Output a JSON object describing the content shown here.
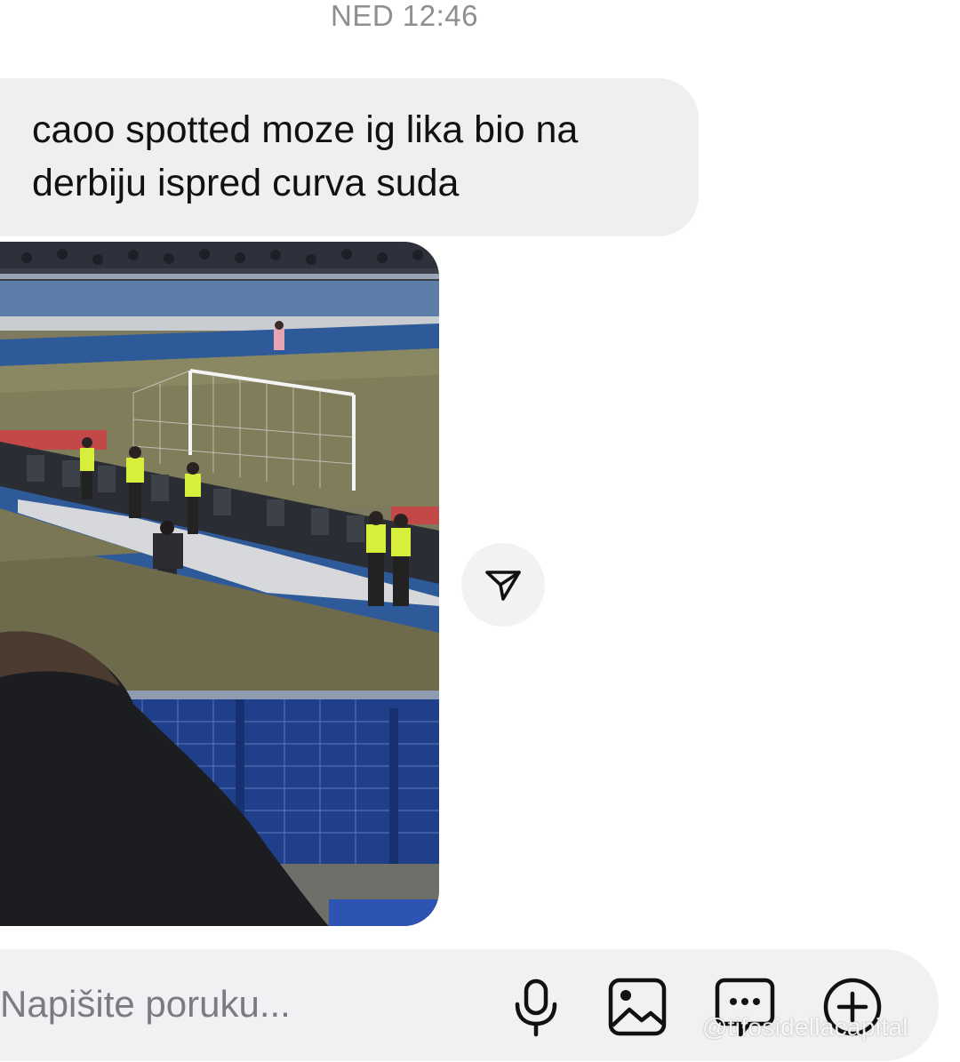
{
  "header": {
    "timestamp": "NED 12:46"
  },
  "messages": [
    {
      "type": "text",
      "text": "caoo spotted moze ig lika bio na\nderbiju ispred curva suda"
    },
    {
      "type": "image",
      "alt": ""
    }
  ],
  "composer": {
    "placeholder": "Napišite poruku...",
    "value": "",
    "icons": [
      "microphone-icon",
      "gallery-icon",
      "sticker-message-icon",
      "add-icon"
    ]
  },
  "share_icon": "send-paper-plane-icon",
  "watermark": "@tifosidellacapital"
}
